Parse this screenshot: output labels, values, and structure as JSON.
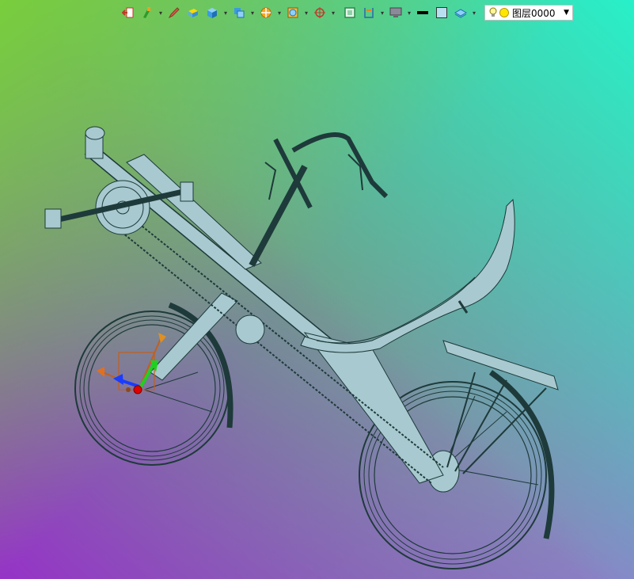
{
  "toolbar": {
    "buttons": [
      {
        "id": "exit",
        "icon": "exit-sketch-icon",
        "has_dropdown": false
      },
      {
        "id": "paint",
        "icon": "paint-brush-icon",
        "has_dropdown": true
      },
      {
        "id": "pencil",
        "icon": "pencil-icon",
        "has_dropdown": false
      },
      {
        "id": "face",
        "icon": "face-highlight-icon",
        "has_dropdown": false
      },
      {
        "id": "solid",
        "icon": "solid-cube-icon",
        "has_dropdown": true
      },
      {
        "id": "view",
        "icon": "view-orientation-icon",
        "has_dropdown": true
      },
      {
        "id": "section",
        "icon": "section-view-icon",
        "has_dropdown": true
      },
      {
        "id": "display",
        "icon": "display-mode-icon",
        "has_dropdown": true
      },
      {
        "id": "snap",
        "icon": "snap-target-icon",
        "has_dropdown": true
      },
      {
        "id": "fit",
        "icon": "fit-view-icon",
        "has_dropdown": false
      },
      {
        "id": "dimension",
        "icon": "dimension-icon",
        "has_dropdown": true
      },
      {
        "id": "screen",
        "icon": "monitor-icon",
        "has_dropdown": true
      },
      {
        "id": "line_color",
        "icon": "line-color-icon",
        "has_dropdown": false
      },
      {
        "id": "fill_color",
        "icon": "fill-color-icon",
        "has_dropdown": false
      },
      {
        "id": "layers",
        "icon": "layers-icon",
        "has_dropdown": true
      }
    ],
    "layer": {
      "value": "图层0000",
      "icons": [
        "lightbulb-icon",
        "sun-icon"
      ]
    }
  },
  "colors": {
    "gradient_top_left": "#7ccf3a",
    "gradient_top_right": "#2af0c8",
    "gradient_bottom_left": "#9a35c8",
    "gradient_bottom_right": "#8c82c8",
    "model_fill": "#a7c9cf",
    "model_edge": "#1e3a3a",
    "line_color_swatch": "#000000",
    "fill_color_swatch": "#b8dff0"
  },
  "model": {
    "name": "recumbent-bicycle",
    "triad_axes": [
      "x-axis-arrow",
      "y-axis-arrow",
      "z-axis-arrow"
    ]
  }
}
